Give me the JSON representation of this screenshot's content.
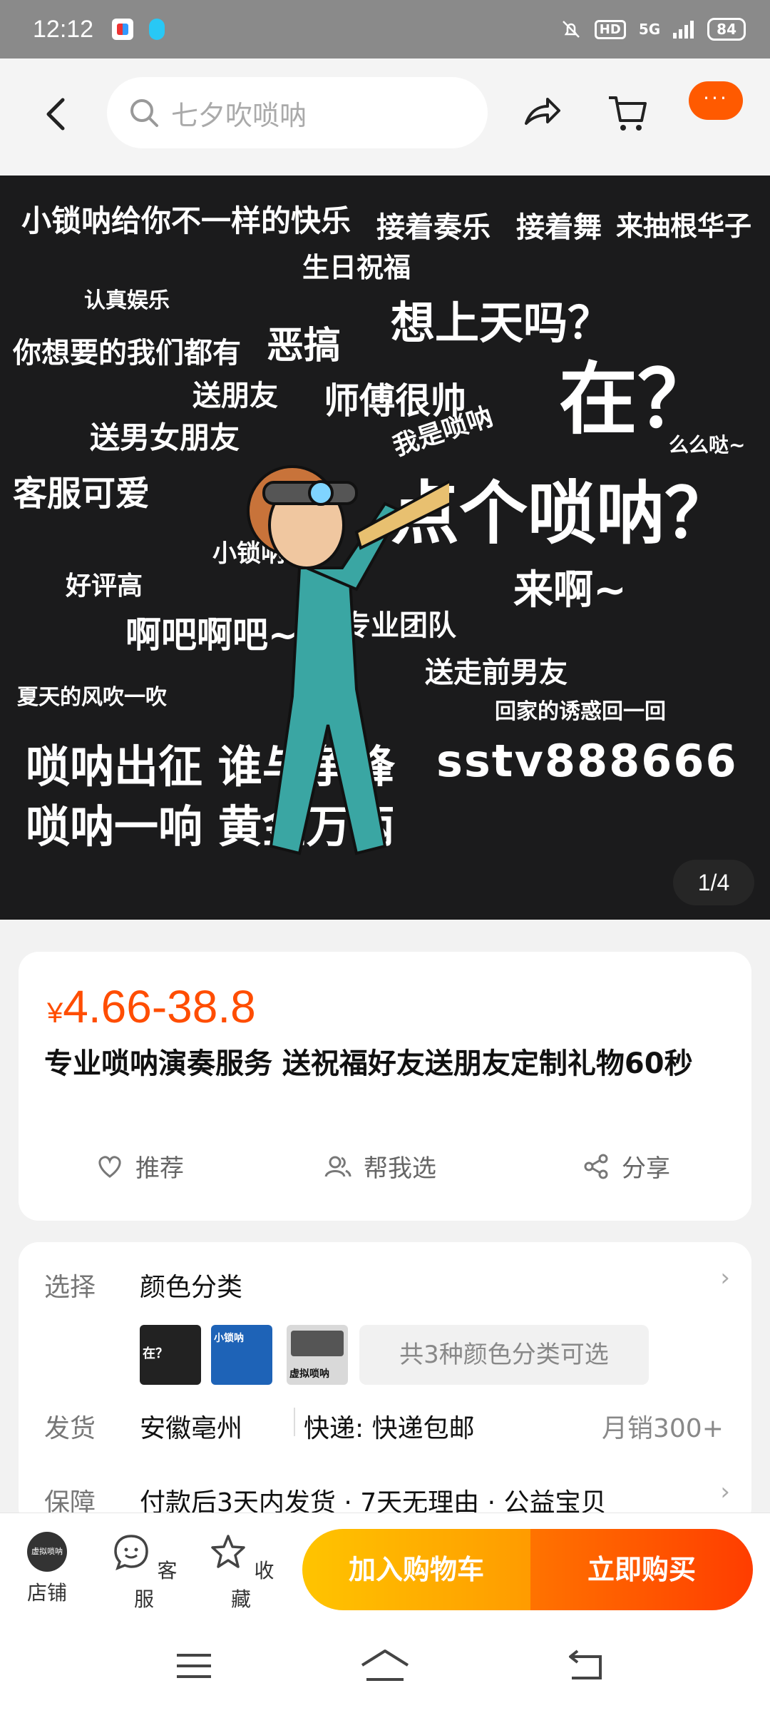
{
  "status_bar": {
    "time": "12:12",
    "network": "5G",
    "hd": "HD",
    "battery": "84"
  },
  "top_nav": {
    "search_placeholder": "七夕吹唢呐",
    "more": "···"
  },
  "banner": {
    "texts": [
      "小锁呐给你不一样的快乐",
      "接着奏乐",
      "接着舞",
      "来抽根华子",
      "生日祝福",
      "认真娱乐",
      "想上天吗？",
      "你想要的我们都有",
      "恶搞",
      "在？",
      "送朋友",
      "师傅很帅",
      "送男女朋友",
      "我是唢呐",
      "么么哒~",
      "客服可爱",
      "点个唢呐？",
      "小锁呐",
      "好评高",
      "来啊~",
      "啊吧啊吧~",
      "专业团队",
      "送走前男友",
      "夏天的风吹一吹",
      "回家的诱惑回一回",
      "唢呐出征 谁与争锋",
      "唢呐一响 黄金万两",
      "sstv888666"
    ],
    "counter": "1/4"
  },
  "product": {
    "currency": "¥",
    "price_range": "4.66-38.8",
    "title": "专业唢呐演奏服务 送祝福好友送朋友定制礼物60秒",
    "actions": {
      "recommend": "推荐",
      "help_choose": "帮我选",
      "share": "分享"
    }
  },
  "options": {
    "select_label": "选择",
    "select_value": "颜色分类",
    "thumb_captions": [
      "在？",
      "小锁呐",
      "虚拟唢呐"
    ],
    "variants_text": "共3种颜色分类可选",
    "ship_label": "发货",
    "ship_from": "安徽亳州",
    "express": "快递: 快递包邮",
    "monthly_sales": "月销300+",
    "guarantee_label": "保障",
    "guarantee_value": "付款后3天内发货 · 7天无理由 · 公益宝贝"
  },
  "bottom_bar": {
    "store": "店铺",
    "store_logo_text": "虚拟唢呐",
    "service": "客服",
    "favorite": "收藏",
    "add_to_cart": "加入购物车",
    "buy_now": "立即购买"
  },
  "colors": {
    "accent": "#ff4d00",
    "cart_button": "#ffb000",
    "buy_button": "#ff5500"
  }
}
